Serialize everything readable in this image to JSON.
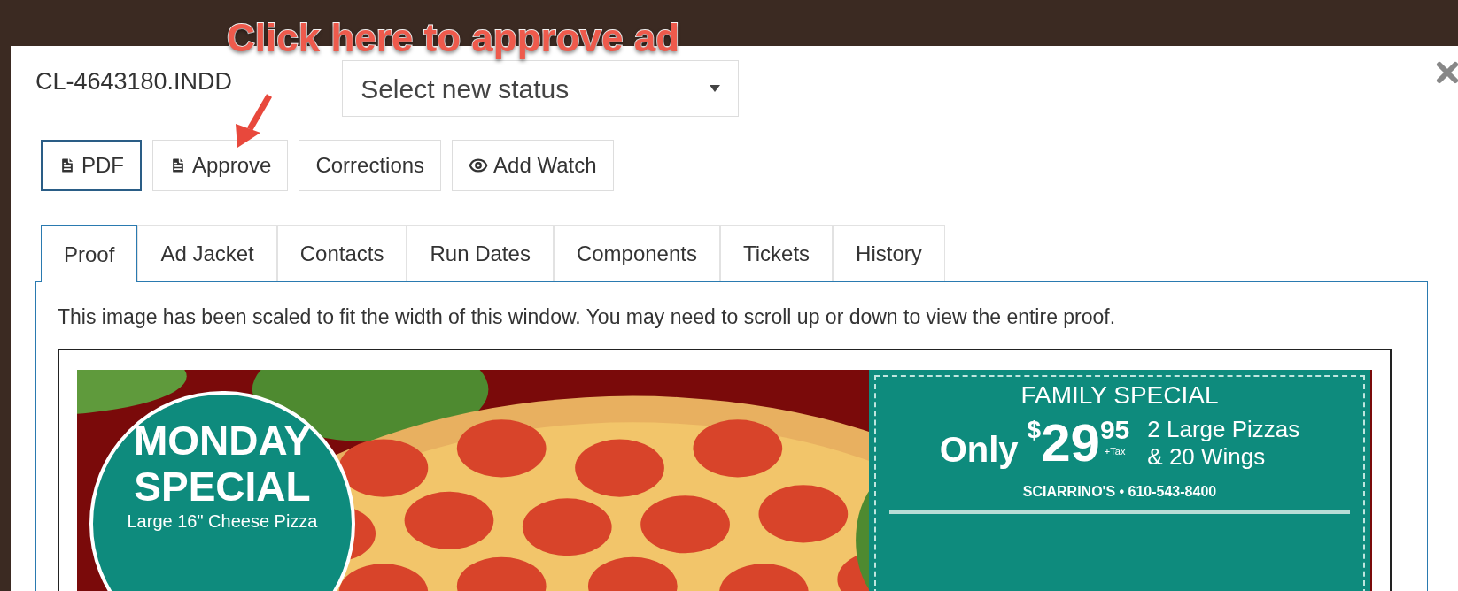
{
  "annotation": {
    "text": "Click here to approve ad"
  },
  "dialog": {
    "title": "CL-4643180.INDD",
    "status_select": {
      "value": "Select new status"
    },
    "buttons": [
      {
        "label": "PDF",
        "kind": "file",
        "selected": true
      },
      {
        "label": "Approve",
        "kind": "file",
        "selected": false
      },
      {
        "label": "Corrections",
        "kind": "plain",
        "selected": false
      },
      {
        "label": "Add Watch",
        "kind": "watch",
        "selected": false
      }
    ],
    "tabs": [
      {
        "label": "Proof",
        "selected": true
      },
      {
        "label": "Ad Jacket",
        "selected": false
      },
      {
        "label": "Contacts",
        "selected": false
      },
      {
        "label": "Run Dates",
        "selected": false
      },
      {
        "label": "Components",
        "selected": false
      },
      {
        "label": "Tickets",
        "selected": false
      },
      {
        "label": "History",
        "selected": false
      }
    ],
    "notice": "This image has been scaled to fit the width of this window. You may need to scroll up or down to view the entire proof.",
    "proof": {
      "badge": {
        "line1": "MONDAY",
        "line2": "SPECIAL",
        "line3": "Large 16\" Cheese Pizza"
      },
      "coupon": {
        "heading": "FAMILY SPECIAL",
        "only": "Only",
        "currency": "$",
        "price": "29",
        "cents": "95",
        "tax": "+Tax",
        "offer1": "2 Large Pizzas",
        "offer2": "& 20 Wings",
        "contact": "SCIARRINO'S • 610-543-8400"
      }
    }
  }
}
